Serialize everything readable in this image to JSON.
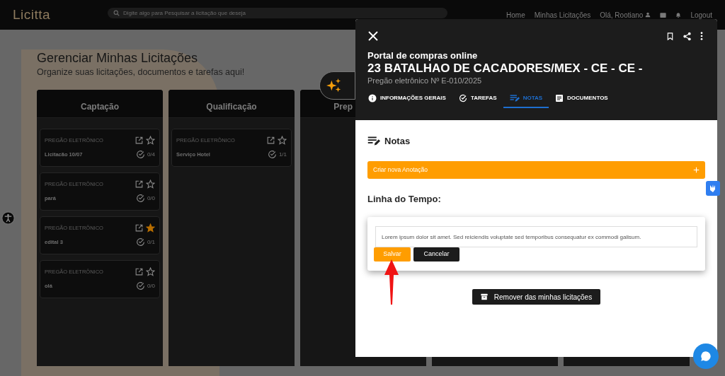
{
  "navbar": {
    "logo": "Licitta",
    "search_placeholder": "Digite algo para Pesquisar a licitação que deseja",
    "links": [
      {
        "label": "Home"
      },
      {
        "label": "Minhas Licitações"
      },
      {
        "label": "Olá, Rootiano"
      },
      {
        "label": "Logout"
      }
    ]
  },
  "page": {
    "title": "Gerenciar Minhas Licitações",
    "subtitle": "Organize suas licitações, documentos e tarefas aqui!"
  },
  "columns": [
    {
      "title": "Captação",
      "cards": [
        {
          "category": "PREGÃO ELETRÔNICO",
          "name": "Licitacão 10/07",
          "progress": "0/4",
          "starred": false
        },
        {
          "category": "PREGÃO ELETRÔNICO",
          "name": "pará",
          "progress": "0/0",
          "starred": false
        },
        {
          "category": "PREGÃO ELETRÔNICO",
          "name": "edital 3",
          "progress": "0/1",
          "starred": true
        },
        {
          "category": "PREGÃO ELETRÔNICO",
          "name": "olá",
          "progress": "0/0",
          "starred": false
        }
      ]
    },
    {
      "title": "Qualificação",
      "cards": [
        {
          "category": "PREGÃO ELETRÔNICO",
          "name": "Serviço Hotel",
          "progress": "1/1",
          "starred": false
        }
      ]
    },
    {
      "title": "Prep"
    },
    {},
    {}
  ],
  "panel": {
    "portal": "Portal de compras online",
    "title": "23 BATALHAO DE CACADORES/MEX - CE - CE -",
    "subtitle": "Pregão eletrônico Nº E-010/2025",
    "tabs": [
      {
        "label": "INFORMAÇÕES GERAIS",
        "kind": "info",
        "selected": false
      },
      {
        "label": "TAREFAS",
        "kind": "tasks",
        "selected": false
      },
      {
        "label": "NOTAS",
        "kind": "notes",
        "selected": true
      },
      {
        "label": "DOCUMENTOS",
        "kind": "docs",
        "selected": false
      }
    ],
    "section_title": "Notas",
    "new_note": "Criar nova Anotação",
    "timeline_title": "Linha do Tempo:",
    "editor": {
      "value": "Lorem ipsum dolor sit amet. Sed reiciendis voluptate sed temporibus consequatur ex commodi galisum.",
      "save": "Salvar",
      "cancel": "Cancelar"
    },
    "remove": "Remover das minhas licitações"
  }
}
